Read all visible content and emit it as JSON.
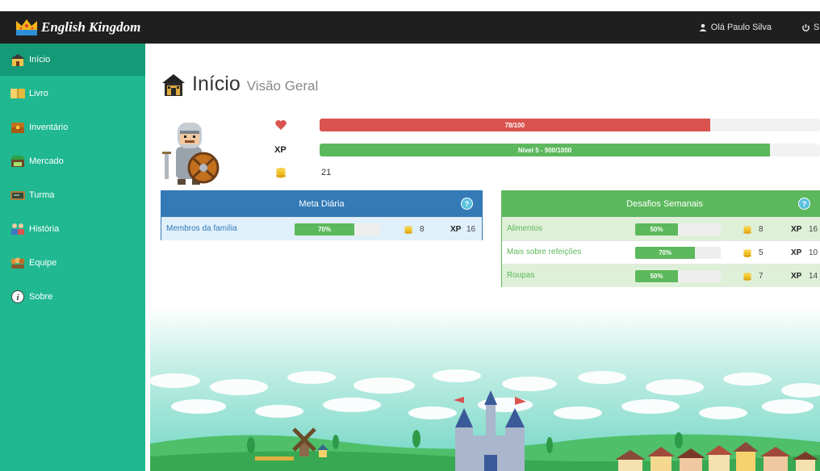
{
  "topbar": {
    "brand": "English Kingdom",
    "user_greeting": "Olá Paulo Silva",
    "logout_label": "S"
  },
  "sidebar": {
    "items": [
      {
        "label": "Início",
        "icon": "house-icon",
        "active": true
      },
      {
        "label": "Livro",
        "icon": "book-icon",
        "active": false
      },
      {
        "label": "Inventário",
        "icon": "chest-icon",
        "active": false
      },
      {
        "label": "Mercado",
        "icon": "market-icon",
        "active": false
      },
      {
        "label": "Turma",
        "icon": "blackboard-icon",
        "active": false
      },
      {
        "label": "História",
        "icon": "story-icon",
        "active": false
      },
      {
        "label": "Equipe",
        "icon": "team-icon",
        "active": false
      },
      {
        "label": "Sobre",
        "icon": "info-icon",
        "active": false
      }
    ]
  },
  "page": {
    "title": "Início",
    "subtitle": "Visão Geral"
  },
  "stats": {
    "health_label": "78/100",
    "health_fraction": 0.78,
    "xp_icon_label": "XP",
    "xp_label": "Nível 5 - 900/1000",
    "xp_fraction": 0.9,
    "coins": "21"
  },
  "daily": {
    "title": "Meta Diária",
    "help": "?",
    "rows": [
      {
        "label": "Membros da família",
        "progress_label": "70%",
        "progress": 0.7,
        "coins": "8",
        "xp_label": "XP",
        "xp": "16"
      }
    ]
  },
  "weekly": {
    "title": "Desafios Semanais",
    "help": "?",
    "rows": [
      {
        "label": "Alimentos",
        "progress_label": "50%",
        "progress": 0.5,
        "coins": "8",
        "xp_label": "XP",
        "xp": "16"
      },
      {
        "label": "Mais sobre refeições",
        "progress_label": "70%",
        "progress": 0.7,
        "coins": "5",
        "xp_label": "XP",
        "xp": "10"
      },
      {
        "label": "Roupas",
        "progress_label": "50%",
        "progress": 0.5,
        "coins": "7",
        "xp_label": "XP",
        "xp": "14"
      }
    ]
  },
  "colors": {
    "sidebar": "#1fb890",
    "sidebar_active": "#159a77",
    "topbar": "#1f1f1f",
    "health": "#d9534f",
    "xp": "#5cb85c",
    "daily_header": "#337ab7",
    "weekly_header": "#5cb85c",
    "coin": "#f0c020"
  }
}
